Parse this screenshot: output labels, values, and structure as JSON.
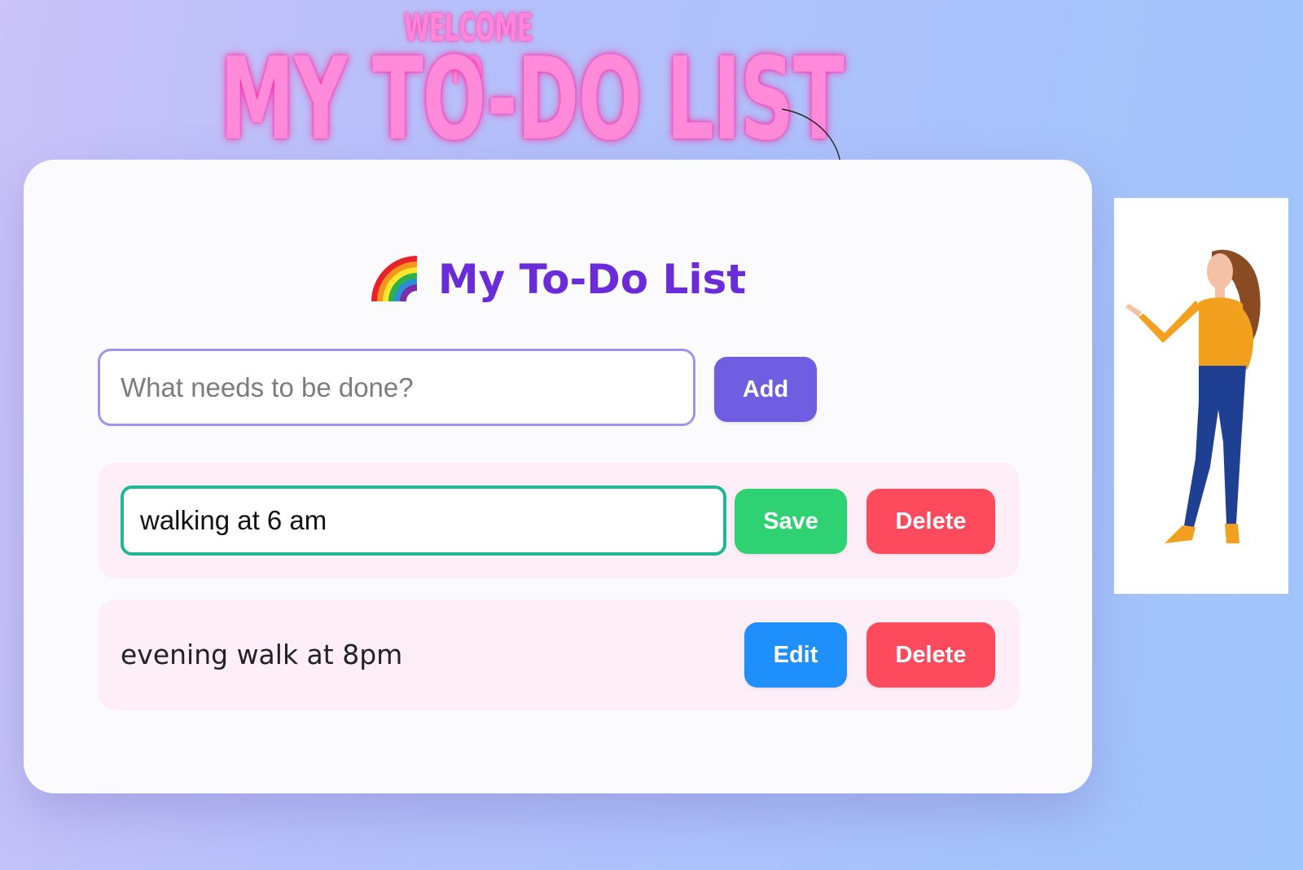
{
  "poster": {
    "welcome": "WELCOME TO",
    "title": "MY TO-DO LIST"
  },
  "app": {
    "title": "My To-Do List",
    "title_icon": "rainbow-icon",
    "new_task": {
      "placeholder": "What needs to be done?",
      "value": ""
    },
    "add_label": "Add",
    "tasks": [
      {
        "text": "walking at 6 am",
        "editing": true,
        "save_label": "Save",
        "delete_label": "Delete"
      },
      {
        "text": "evening walk at 8pm",
        "editing": false,
        "edit_label": "Edit",
        "delete_label": "Delete"
      }
    ]
  },
  "colors": {
    "title": "#6a2bd9",
    "add_button": "#6f5de2",
    "save_button": "#2fd272",
    "delete_button": "#fd4a5c",
    "edit_button": "#1e8ffb",
    "task_background": "#fdeef7",
    "poster_title": "#ff8ad9"
  }
}
